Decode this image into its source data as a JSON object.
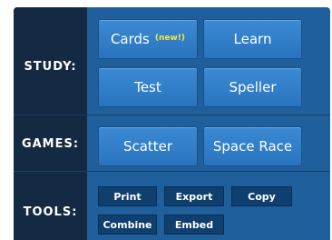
{
  "sections": {
    "study": {
      "label": "STUDY:"
    },
    "games": {
      "label": "GAMES:"
    },
    "tools": {
      "label": "TOOLS:"
    }
  },
  "study_buttons": {
    "cards": "Cards",
    "cards_badge": "(new!)",
    "learn": "Learn",
    "test": "Test",
    "speller": "Speller"
  },
  "game_buttons": {
    "scatter": "Scatter",
    "space_race": "Space Race"
  },
  "tool_buttons": {
    "print": "Print",
    "export": "Export",
    "copy": "Copy",
    "combine": "Combine",
    "embed": "Embed"
  },
  "colors": {
    "panel_bg": "#1f5f9c",
    "label_column_bg": "#142a42",
    "button_bg": "#2f7fca",
    "tool_button_bg": "#0f3f6e",
    "badge": "#f2e64a"
  }
}
